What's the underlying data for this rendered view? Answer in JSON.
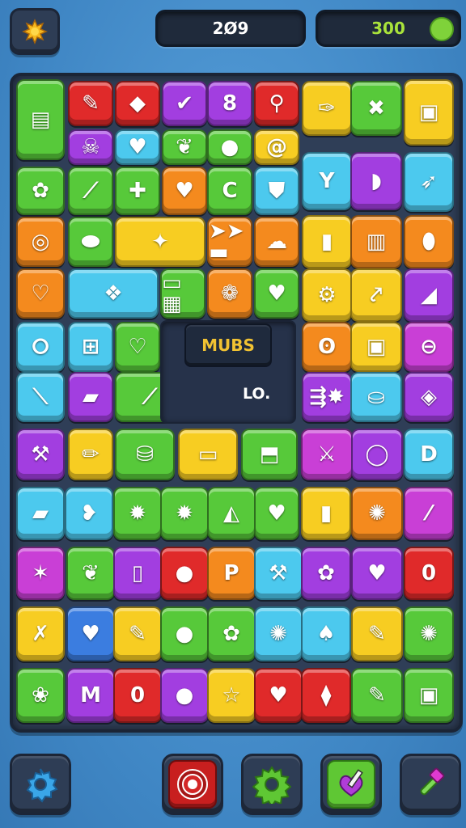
{
  "header": {
    "left_counter": "2Ø9",
    "right_counter": "300",
    "menu_icon": "sun-gear-icon",
    "right_icon": "leaf-coin-icon"
  },
  "board": {
    "center_label": "MUBS",
    "center_text": "LO."
  },
  "bottom_bar": {
    "buttons": [
      {
        "name": "settings-button",
        "icon": "gear-icon",
        "color": "#3aa6e8"
      },
      {
        "name": "target-button",
        "icon": "target-icon",
        "color": "#d22a2a"
      },
      {
        "name": "cog-button",
        "icon": "cog-icon",
        "color": "#5fc734"
      },
      {
        "name": "edit-button",
        "icon": "pencil-heart-icon",
        "color": "#5fc734"
      },
      {
        "name": "hammer-button",
        "icon": "hammer-icon",
        "color": "#7ed957"
      }
    ]
  },
  "colors": {
    "green": "#57c93a",
    "red": "#e02a2a",
    "purple": "#a23ee0",
    "yellow": "#f7cd22",
    "orange": "#f48a1e",
    "cyan": "#4cc9ee",
    "blue": "#3b7de0",
    "magenta": "#c93fd6"
  },
  "tiles": [
    {
      "name": "tile-notepad",
      "c": "green",
      "g": "▤"
    },
    {
      "name": "tile-pencil",
      "c": "red",
      "g": "✎"
    },
    {
      "name": "tile-gem",
      "c": "red",
      "g": "◆"
    },
    {
      "name": "tile-check",
      "c": "purple",
      "g": "✔"
    },
    {
      "name": "tile-b-block",
      "c": "purple",
      "g": "8"
    },
    {
      "name": "tile-magnifier",
      "c": "red",
      "g": "⚲"
    },
    {
      "name": "tile-pin",
      "c": "yellow",
      "g": "✑"
    },
    {
      "name": "tile-x",
      "c": "green",
      "g": "✖"
    },
    {
      "name": "tile-bag",
      "c": "yellow",
      "g": "▣"
    },
    {
      "name": "tile-skull",
      "c": "purple",
      "g": "☠"
    },
    {
      "name": "tile-heart-small",
      "c": "cyan",
      "g": "♥"
    },
    {
      "name": "tile-leaf",
      "c": "green",
      "g": "❦"
    },
    {
      "name": "tile-ball",
      "c": "green",
      "g": "●"
    },
    {
      "name": "tile-at",
      "c": "yellow",
      "g": "@"
    },
    {
      "name": "tile-cup",
      "c": "cyan",
      "g": "Y"
    },
    {
      "name": "tile-capsule",
      "c": "purple",
      "g": "◗"
    },
    {
      "name": "tile-carrot",
      "c": "cyan",
      "g": "➶"
    },
    {
      "name": "tile-flower",
      "c": "green",
      "g": "✿"
    },
    {
      "name": "tile-stick",
      "c": "green",
      "g": "⟋"
    },
    {
      "name": "tile-bandage",
      "c": "green",
      "g": "✚"
    },
    {
      "name": "tile-heart",
      "c": "orange",
      "g": "♥"
    },
    {
      "name": "tile-c",
      "c": "green",
      "g": "C"
    },
    {
      "name": "tile-shield",
      "c": "cyan",
      "g": "⛊"
    },
    {
      "name": "tile-ring",
      "c": "orange",
      "g": "◎"
    },
    {
      "name": "tile-egg",
      "c": "green",
      "g": "⬬"
    },
    {
      "name": "tile-star",
      "c": "yellow",
      "g": "✦"
    },
    {
      "name": "tile-arrows",
      "c": "orange",
      "g": "➤➤ ▬"
    },
    {
      "name": "tile-cloud",
      "c": "orange",
      "g": "☁"
    },
    {
      "name": "tile-phone",
      "c": "yellow",
      "g": "▮"
    },
    {
      "name": "tile-book",
      "c": "orange",
      "g": "▥"
    },
    {
      "name": "tile-bottle",
      "c": "orange",
      "g": "⬮"
    },
    {
      "name": "tile-hearts",
      "c": "orange",
      "g": "♡"
    },
    {
      "name": "tile-crystal",
      "c": "cyan",
      "g": "❖"
    },
    {
      "name": "tile-battery",
      "c": "green",
      "g": "▭ ▦"
    },
    {
      "name": "tile-flower-red",
      "c": "orange",
      "g": "❁"
    },
    {
      "name": "tile-heart-yellow",
      "c": "green",
      "g": "♥"
    },
    {
      "name": "tile-frame",
      "c": "yellow",
      "g": "⚙"
    },
    {
      "name": "tile-wand",
      "c": "yellow",
      "g": "⤤"
    },
    {
      "name": "tile-slash",
      "c": "purple",
      "g": "◢"
    },
    {
      "name": "tile-donut",
      "c": "cyan",
      "g": "⭘"
    },
    {
      "name": "tile-calc",
      "c": "cyan",
      "g": "⊞"
    },
    {
      "name": "tile-heart-green",
      "c": "green",
      "g": "♡"
    },
    {
      "name": "tile-bear",
      "c": "orange",
      "g": "ʘ"
    },
    {
      "name": "tile-screen",
      "c": "yellow",
      "g": "▣"
    },
    {
      "name": "tile-toggle",
      "c": "magenta",
      "g": "⊖"
    },
    {
      "name": "tile-brush",
      "c": "cyan",
      "g": "⟍"
    },
    {
      "name": "tile-eraser",
      "c": "purple",
      "g": "▰"
    },
    {
      "name": "tile-syringe",
      "c": "green",
      "g": "⟋"
    },
    {
      "name": "tile-arrow-spark",
      "c": "purple",
      "g": "⇶✸"
    },
    {
      "name": "tile-basket",
      "c": "cyan",
      "g": "⛀"
    },
    {
      "name": "tile-gem-cyan",
      "c": "purple",
      "g": "◈"
    },
    {
      "name": "tile-wrench",
      "c": "purple",
      "g": "⚒"
    },
    {
      "name": "tile-crayon",
      "c": "yellow",
      "g": "✏"
    },
    {
      "name": "tile-jar",
      "c": "green",
      "g": "⛁"
    },
    {
      "name": "tile-bar",
      "c": "yellow",
      "g": "▭"
    },
    {
      "name": "tile-box",
      "c": "green",
      "g": "⬒"
    },
    {
      "name": "tile-tool",
      "c": "magenta",
      "g": "⚔"
    },
    {
      "name": "tile-o-ring",
      "c": "purple",
      "g": "◯"
    },
    {
      "name": "tile-d",
      "c": "cyan",
      "g": "D"
    },
    {
      "name": "tile-eraser-2",
      "c": "cyan",
      "g": "▰"
    },
    {
      "name": "tile-heart-puzzle",
      "c": "cyan",
      "g": "❥"
    },
    {
      "name": "tile-star-cyan",
      "c": "green",
      "g": "✹"
    },
    {
      "name": "tile-star-cyan-2",
      "c": "green",
      "g": "✹"
    },
    {
      "name": "tile-bird",
      "c": "green",
      "g": "◭"
    },
    {
      "name": "tile-heart-red",
      "c": "green",
      "g": "♥"
    },
    {
      "name": "tile-can",
      "c": "yellow",
      "g": "▮"
    },
    {
      "name": "tile-cog-red",
      "c": "orange",
      "g": "✺"
    },
    {
      "name": "tile-feather",
      "c": "magenta",
      "g": "⁄"
    },
    {
      "name": "tile-splash",
      "c": "magenta",
      "g": "✶"
    },
    {
      "name": "tile-leaf-yellow",
      "c": "green",
      "g": "❦"
    },
    {
      "name": "tile-paper",
      "c": "purple",
      "g": "▯"
    },
    {
      "name": "tile-orb",
      "c": "red",
      "g": "●"
    },
    {
      "name": "tile-p",
      "c": "orange",
      "g": "P"
    },
    {
      "name": "tile-shovel",
      "c": "cyan",
      "g": "⚒"
    },
    {
      "name": "tile-blob",
      "c": "purple",
      "g": "✿"
    },
    {
      "name": "tile-heart-dark",
      "c": "purple",
      "g": "♥"
    },
    {
      "name": "tile-capsule-red",
      "c": "red",
      "g": "0"
    },
    {
      "name": "tile-crossed",
      "c": "yellow",
      "g": "✗"
    },
    {
      "name": "tile-heart-purple",
      "c": "blue",
      "g": "♥"
    },
    {
      "name": "tile-pen-blue",
      "c": "yellow",
      "g": "✎"
    },
    {
      "name": "tile-apple",
      "c": "green",
      "g": "●"
    },
    {
      "name": "tile-splat",
      "c": "green",
      "g": "✿"
    },
    {
      "name": "tile-gear-purple",
      "c": "cyan",
      "g": "✺"
    },
    {
      "name": "tile-drop",
      "c": "cyan",
      "g": "♠"
    },
    {
      "name": "tile-marker",
      "c": "yellow",
      "g": "✎"
    },
    {
      "name": "tile-sun",
      "c": "green",
      "g": "✺"
    },
    {
      "name": "tile-blob-green",
      "c": "green",
      "g": "❀"
    },
    {
      "name": "tile-m",
      "c": "purple",
      "g": "M"
    },
    {
      "name": "tile-0",
      "c": "red",
      "g": "0"
    },
    {
      "name": "tile-ball-green",
      "c": "purple",
      "g": "●"
    },
    {
      "name": "tile-star-white",
      "c": "yellow",
      "g": "☆"
    },
    {
      "name": "tile-heart-green-2",
      "c": "red",
      "g": "♥"
    },
    {
      "name": "tile-kite",
      "c": "red",
      "g": "⧫"
    },
    {
      "name": "tile-pen-pink",
      "c": "green",
      "g": "✎"
    },
    {
      "name": "tile-cube",
      "c": "green",
      "g": "▣"
    },
    {
      "name": "tile-play",
      "c": "green",
      "g": "▷"
    }
  ]
}
